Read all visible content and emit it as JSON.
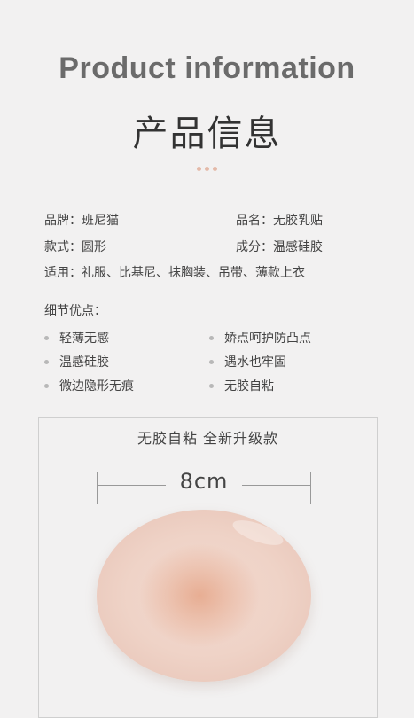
{
  "header": {
    "title_en": "Product information",
    "title_cn": "产品信息"
  },
  "specs": {
    "brand": "品牌：班尼猫",
    "name": "品名：无胶乳贴",
    "style": "款式：圆形",
    "material": "成分：温感硅胶",
    "usage": "适用：礼服、比基尼、抹胸装、吊带、薄款上衣"
  },
  "details": {
    "title": "细节优点：",
    "features_left": [
      "轻薄无感",
      "温感硅胶",
      "微边隐形无痕"
    ],
    "features_right": [
      "娇点呵护防凸点",
      "遇水也牢固",
      "无胶自粘"
    ]
  },
  "product_box": {
    "header": "无胶自粘 全新升级款",
    "size_label": "8cm"
  },
  "colors": {
    "background": "#f2f1f1",
    "accent_dots": "#e4b9a8",
    "pad": "#efd3c7"
  }
}
